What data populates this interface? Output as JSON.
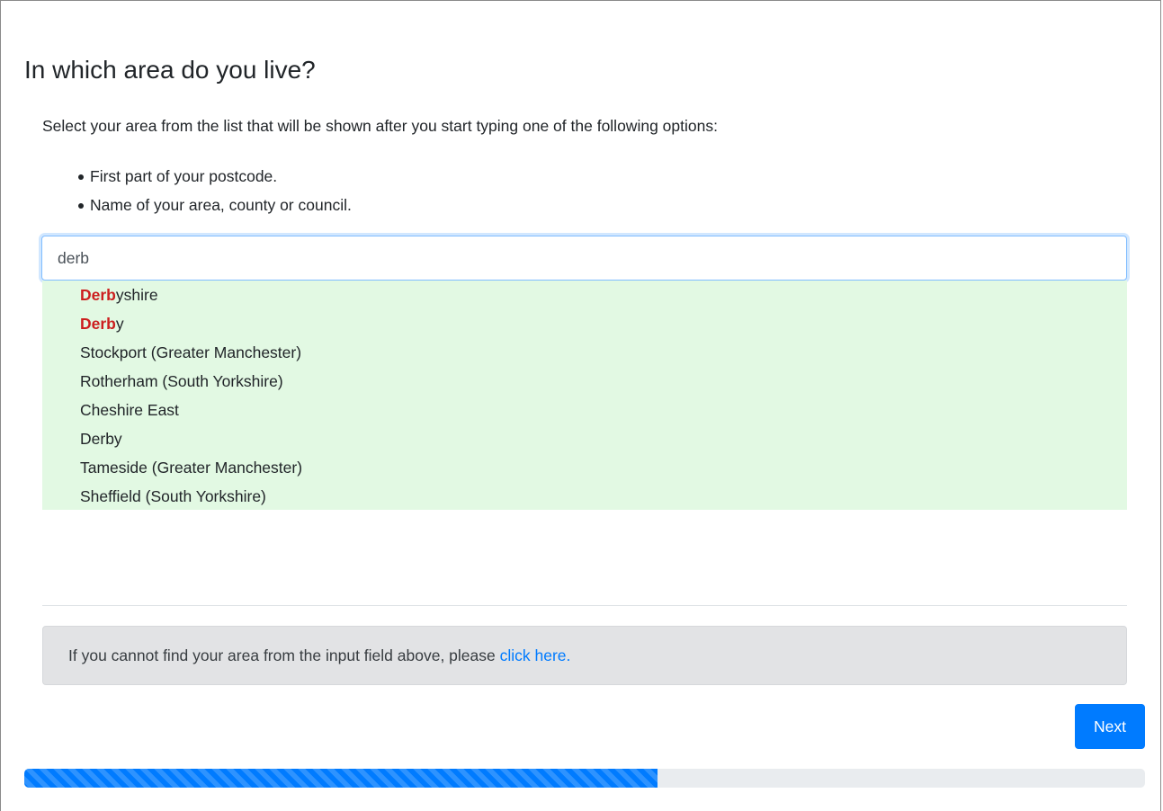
{
  "page": {
    "title": "In which area do you live?",
    "intro": "Select your area from the list that will be shown after you start typing one of the following options:",
    "options": [
      "First part of your postcode.",
      "Name of your area, county or council."
    ]
  },
  "search": {
    "value": "derb"
  },
  "suggestions": [
    {
      "match": "Derb",
      "rest": "yshire"
    },
    {
      "match": "Derb",
      "rest": "y"
    },
    {
      "match": "",
      "rest": "Stockport (Greater Manchester)"
    },
    {
      "match": "",
      "rest": "Rotherham (South Yorkshire)"
    },
    {
      "match": "",
      "rest": "Cheshire East"
    },
    {
      "match": "",
      "rest": "Derby"
    },
    {
      "match": "",
      "rest": "Tameside (Greater Manchester)"
    },
    {
      "match": "",
      "rest": "Sheffield (South Yorkshire)"
    }
  ],
  "notice": {
    "text": "If you cannot find your area from the input field above, please ",
    "link": "click here."
  },
  "buttons": {
    "next": "Next"
  },
  "progress": {
    "fraction": 0.565
  },
  "colors": {
    "primary": "#007bff",
    "highlight": "#cc1f1f",
    "suggestions_bg": "#e2f9e3",
    "notice_bg": "#e2e3e5"
  }
}
